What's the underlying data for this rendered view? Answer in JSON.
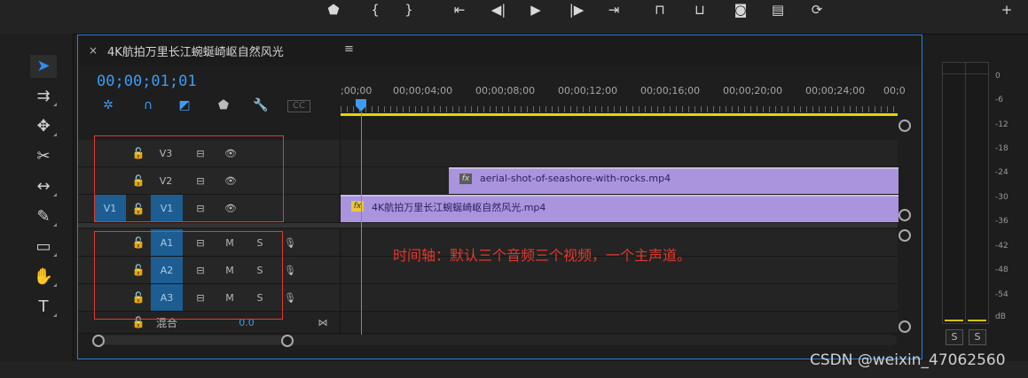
{
  "timeline": {
    "title": "4K航拍万里长江蜿蜒崎岖自然风光",
    "close_glyph": "×",
    "menu_glyph": "≡",
    "timecode": "00;00;01;01",
    "ruler_labels": [
      ";00;00",
      "00;00;04;00",
      "00;00;08;00",
      "00;00;12;00",
      "00;00;16;00",
      "00;00;20;00",
      "00;00;24;00",
      "00;0"
    ]
  },
  "tracks": {
    "video": [
      {
        "name": "V3"
      },
      {
        "name": "V2"
      },
      {
        "name": "V1",
        "source": "V1"
      }
    ],
    "audio": [
      {
        "name": "A1",
        "m": "M",
        "s": "S"
      },
      {
        "name": "A2",
        "m": "M",
        "s": "S"
      },
      {
        "name": "A3",
        "m": "M",
        "s": "S"
      }
    ],
    "mix": {
      "label": "混合",
      "value": "0.0"
    }
  },
  "clips": [
    {
      "name": "aerial-shot-of-seashore-with-rocks.mp4",
      "fx": "fx"
    },
    {
      "name": "4K航拍万里长江蜿蜒崎岖自然风光.mp4",
      "fx": "fx"
    }
  ],
  "meter": {
    "scale": [
      "0",
      "-6",
      "-12",
      "-18",
      "-24",
      "-30",
      "-36",
      "-42",
      "-48",
      "-54",
      "dB"
    ],
    "solo_left": "S",
    "solo_right": "S"
  },
  "annotation": "时间轴：默认三个音频三个视频，一个主声道。",
  "watermark": "CSDN @weixin_47062560",
  "colors": {
    "accent": "#3f9bf0",
    "clip": "#a994dd",
    "work_area": "#e9d500",
    "annotation": "#e0392d"
  },
  "icons": [
    "marker-icon",
    "in-point-icon",
    "out-point-icon",
    "go-to-in-icon",
    "step-back-icon",
    "play-icon",
    "step-forward-icon",
    "go-to-out-icon",
    "lift-icon",
    "extract-icon",
    "camera-icon",
    "compare-icon",
    "loop-icon",
    "add-icon",
    "selection-tool-icon",
    "track-select-tool-icon",
    "ripple-edit-tool-icon",
    "razor-tool-icon",
    "slip-tool-icon",
    "pen-tool-icon",
    "rectangle-tool-icon",
    "hand-tool-icon",
    "type-tool-icon",
    "snap-icon",
    "linked-selection-icon",
    "add-marker-icon",
    "wrench-icon",
    "captions-icon"
  ]
}
